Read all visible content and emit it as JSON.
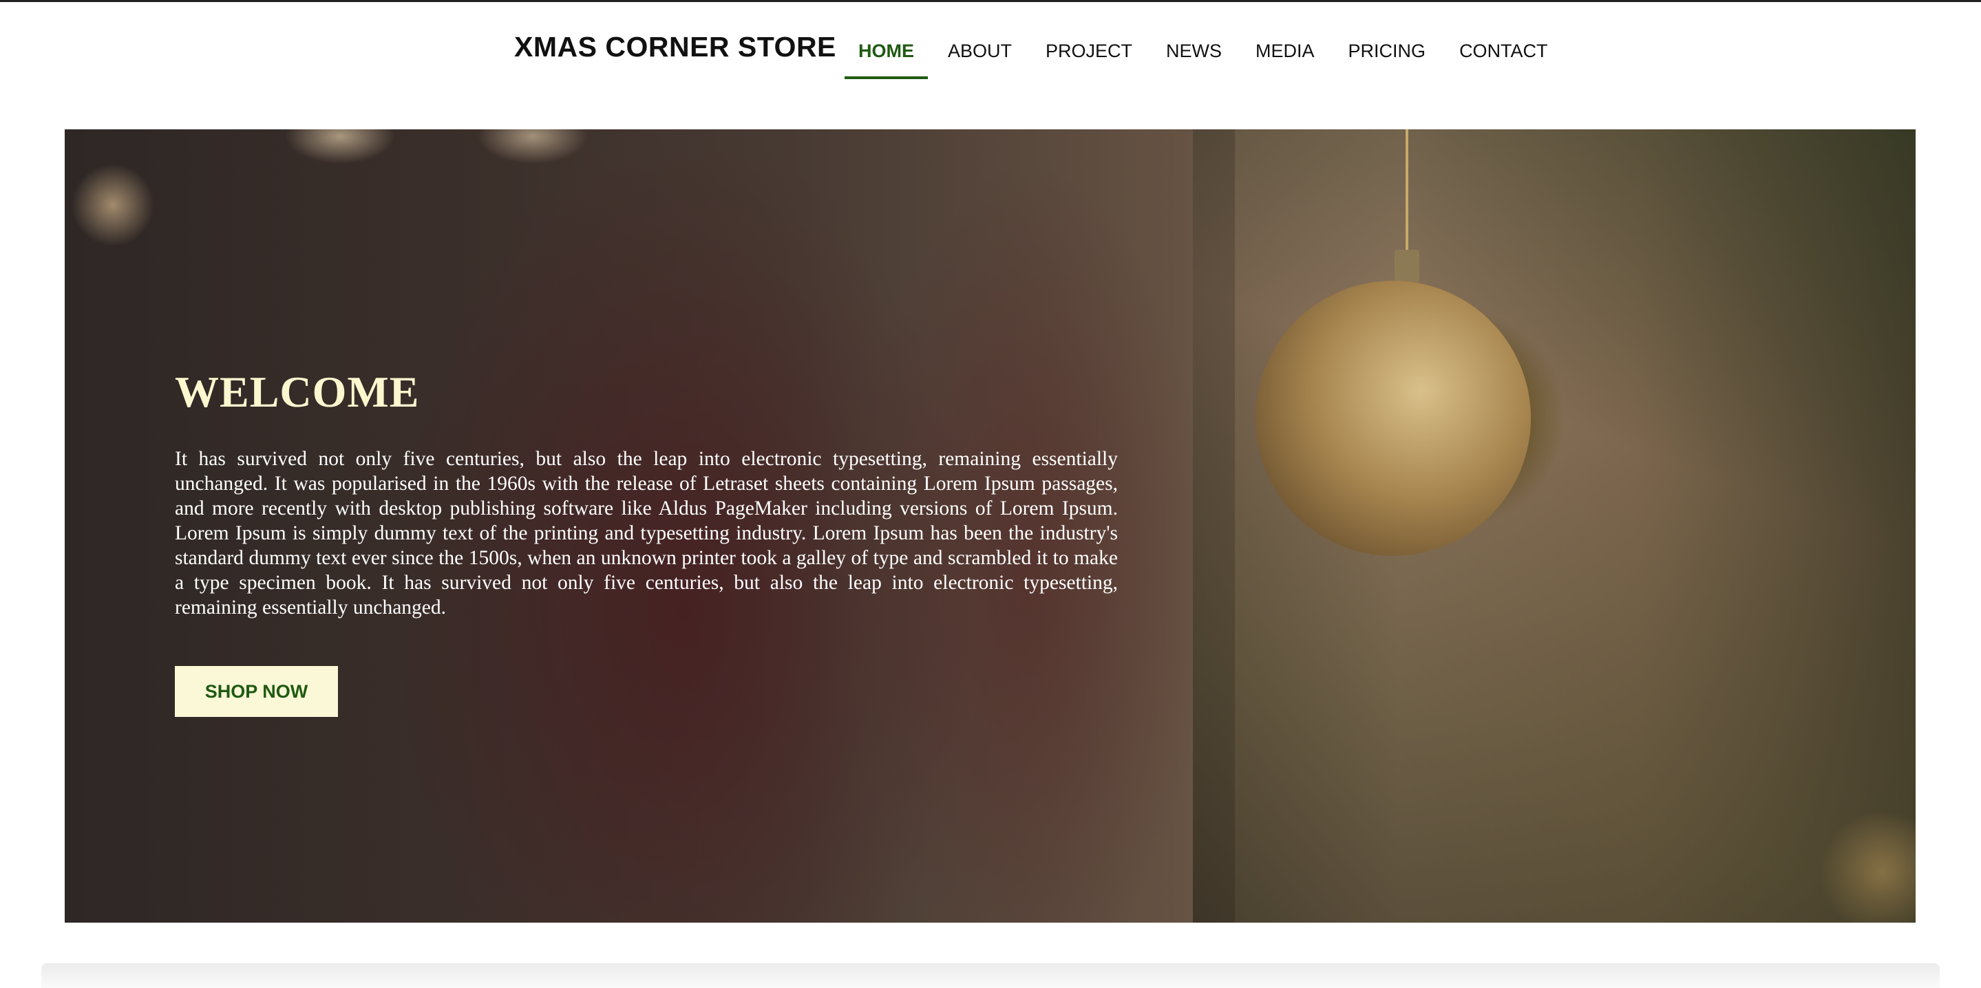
{
  "header": {
    "brand": "XMAS CORNER STORE",
    "nav": [
      {
        "label": "HOME",
        "active": true
      },
      {
        "label": "ABOUT",
        "active": false
      },
      {
        "label": "PROJECT",
        "active": false
      },
      {
        "label": "NEWS",
        "active": false
      },
      {
        "label": "MEDIA",
        "active": false
      },
      {
        "label": "PRICING",
        "active": false
      },
      {
        "label": "CONTACT",
        "active": false
      }
    ]
  },
  "hero": {
    "title": "WELCOME",
    "body": "It has survived not only five centuries, but also the leap into electronic typesetting, remaining essentially unchanged. It was popularised in the 1960s with the release of Letraset sheets containing Lorem Ipsum passages, and more recently with desktop publishing software like Aldus PageMaker including versions of Lorem Ipsum. Lorem Ipsum is simply dummy text of the printing and typesetting industry. Lorem Ipsum has been the industry's standard dummy text ever since the 1500s, when an unknown printer took a galley of type and scrambled it to make a type specimen book. It has survived not only five centuries, but also the leap into electronic typesetting, remaining essentially unchanged.",
    "button_label": "SHOP NOW"
  },
  "colors": {
    "accent": "#1f5a12",
    "title": "#fcf7cf",
    "button_bg": "#fbf8d7"
  }
}
